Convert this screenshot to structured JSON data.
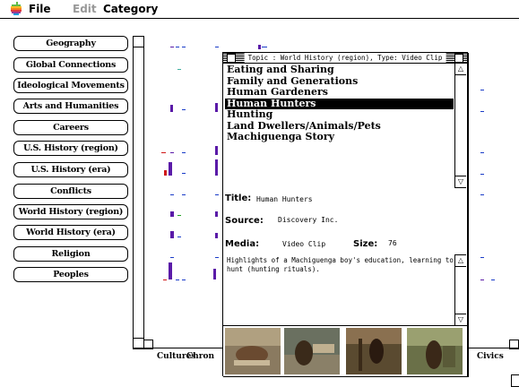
{
  "menubar": {
    "items": [
      "File",
      "Edit",
      "Category"
    ]
  },
  "categories": [
    "Geography",
    "Global Connections",
    "Ideological Movements",
    "Arts and Humanities",
    "Careers",
    "U.S. History (region)",
    "U.S. History (era)",
    "Conflicts",
    "World History (region)",
    "World History (era)",
    "Religion",
    "Peoples"
  ],
  "grid": {
    "column_labels": [
      "Cultures",
      "Chron",
      "Civics"
    ]
  },
  "topic_window": {
    "title": "Topic : World History (region), Type: Video Clip",
    "items": [
      "Eating and Sharing",
      "Family and Generations",
      "Human Gardeners",
      "Human Hunters",
      "Hunting",
      "Land Dwellers/Animals/Pets",
      "Machiguenga Story"
    ],
    "selected_index": 3,
    "title_label": "Title:",
    "title_value": "Human Hunters",
    "source_label": "Source:",
    "source_value": "Discovery Inc.",
    "media_label": "Media:",
    "media_value": "Video Clip",
    "size_label": "Size:",
    "size_value": "76",
    "description": "Highlights of a Machiguenga boy's education, learning to hunt (hunting rituals)."
  },
  "colors": {
    "bar_purple": "#5a1aa8",
    "bar_blue": "#1a3cc8",
    "bar_red": "#d01818",
    "bar_green": "#20a020",
    "bar_teal": "#40b0a0"
  }
}
